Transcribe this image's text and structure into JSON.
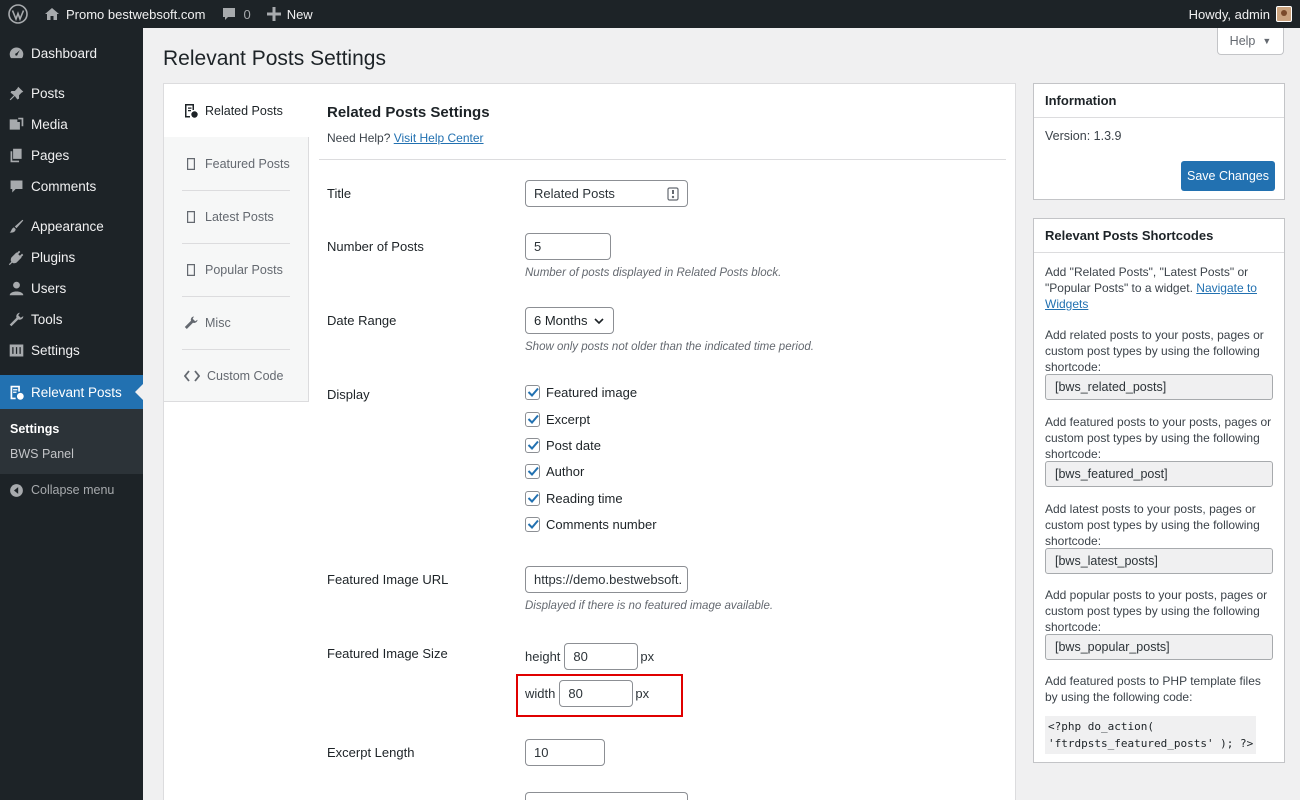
{
  "adminbar": {
    "site_name": "Promo bestwebsoft.com",
    "comments_count": "0",
    "new_label": "New",
    "howdy": "Howdy, admin"
  },
  "sidebar": {
    "items": [
      {
        "label": "Dashboard",
        "icon": "dashboard-icon"
      },
      {
        "label": "Posts",
        "icon": "pushpin-icon"
      },
      {
        "label": "Media",
        "icon": "media-icon"
      },
      {
        "label": "Pages",
        "icon": "pages-icon"
      },
      {
        "label": "Comments",
        "icon": "comment-icon"
      },
      {
        "label": "Appearance",
        "icon": "brush-icon"
      },
      {
        "label": "Plugins",
        "icon": "plug-icon"
      },
      {
        "label": "Users",
        "icon": "user-icon"
      },
      {
        "label": "Tools",
        "icon": "wrench-icon"
      },
      {
        "label": "Settings",
        "icon": "sliders-icon"
      },
      {
        "label": "Relevant Posts",
        "icon": "relevant-posts-icon"
      }
    ],
    "submenu": [
      "Settings",
      "BWS Panel"
    ],
    "collapse": "Collapse menu"
  },
  "page": {
    "title": "Relevant Posts Settings",
    "help_tab": "Help"
  },
  "tabs": [
    {
      "label": "Related Posts",
      "icon": "document-icon"
    },
    {
      "label": "Featured Posts",
      "icon": "page-icon"
    },
    {
      "label": "Latest Posts",
      "icon": "page-icon"
    },
    {
      "label": "Popular Posts",
      "icon": "page-icon"
    },
    {
      "label": "Misc",
      "icon": "wrench-icon"
    },
    {
      "label": "Custom Code",
      "icon": "code-icon"
    }
  ],
  "section": {
    "title": "Related Posts Settings",
    "need_help": "Need Help?",
    "help_link": "Visit Help Center"
  },
  "fields": {
    "title_label": "Title",
    "title_value": "Related Posts",
    "number_label": "Number of Posts",
    "number_value": "5",
    "number_desc": "Number of posts displayed in Related Posts block.",
    "date_label": "Date Range",
    "date_value": "6 Months",
    "date_desc": "Show only posts not older than the indicated time period.",
    "display_label": "Display",
    "display_options": [
      "Featured image",
      "Excerpt",
      "Post date",
      "Author",
      "Reading time",
      "Comments number"
    ],
    "image_url_label": "Featured Image URL",
    "image_url_value": "https://demo.bestwebsoft.",
    "image_url_desc": "Displayed if there is no featured image available.",
    "image_size_label": "Featured Image Size",
    "height_label": "height",
    "height_value": "80",
    "width_label": "width",
    "width_value": "80",
    "px": "px",
    "excerpt_label": "Excerpt Length",
    "excerpt_value": "10"
  },
  "info_box": {
    "title": "Information",
    "version": "Version: 1.3.9",
    "save_label": "Save Changes"
  },
  "shortcodes_box": {
    "title": "Relevant Posts Shortcodes",
    "intro": "Add \"Related Posts\", \"Latest Posts\" or \"Popular Posts\" to a widget.",
    "intro_link": "Navigate to Widgets",
    "related_text": "Add related posts to your posts, pages or custom post types by using the following shortcode:",
    "related_code": "[bws_related_posts]",
    "featured_text": "Add featured posts to your posts, pages or custom post types by using the following shortcode:",
    "featured_code": "[bws_featured_post]",
    "latest_text": "Add latest posts to your posts, pages or custom post types by using the following shortcode:",
    "latest_code": "[bws_latest_posts]",
    "popular_text": "Add popular posts to your posts, pages or custom post types by using the following shortcode:",
    "popular_code": "[bws_popular_posts]",
    "php_text": "Add featured posts to PHP template files by using the following code:",
    "php_line1": "<?php do_action(",
    "php_line2": "'ftrdpsts_featured_posts' ); ?>"
  },
  "colors": {
    "accent": "#2271b1",
    "sidebar_bg": "#1d2327",
    "highlight": "#e00000"
  }
}
